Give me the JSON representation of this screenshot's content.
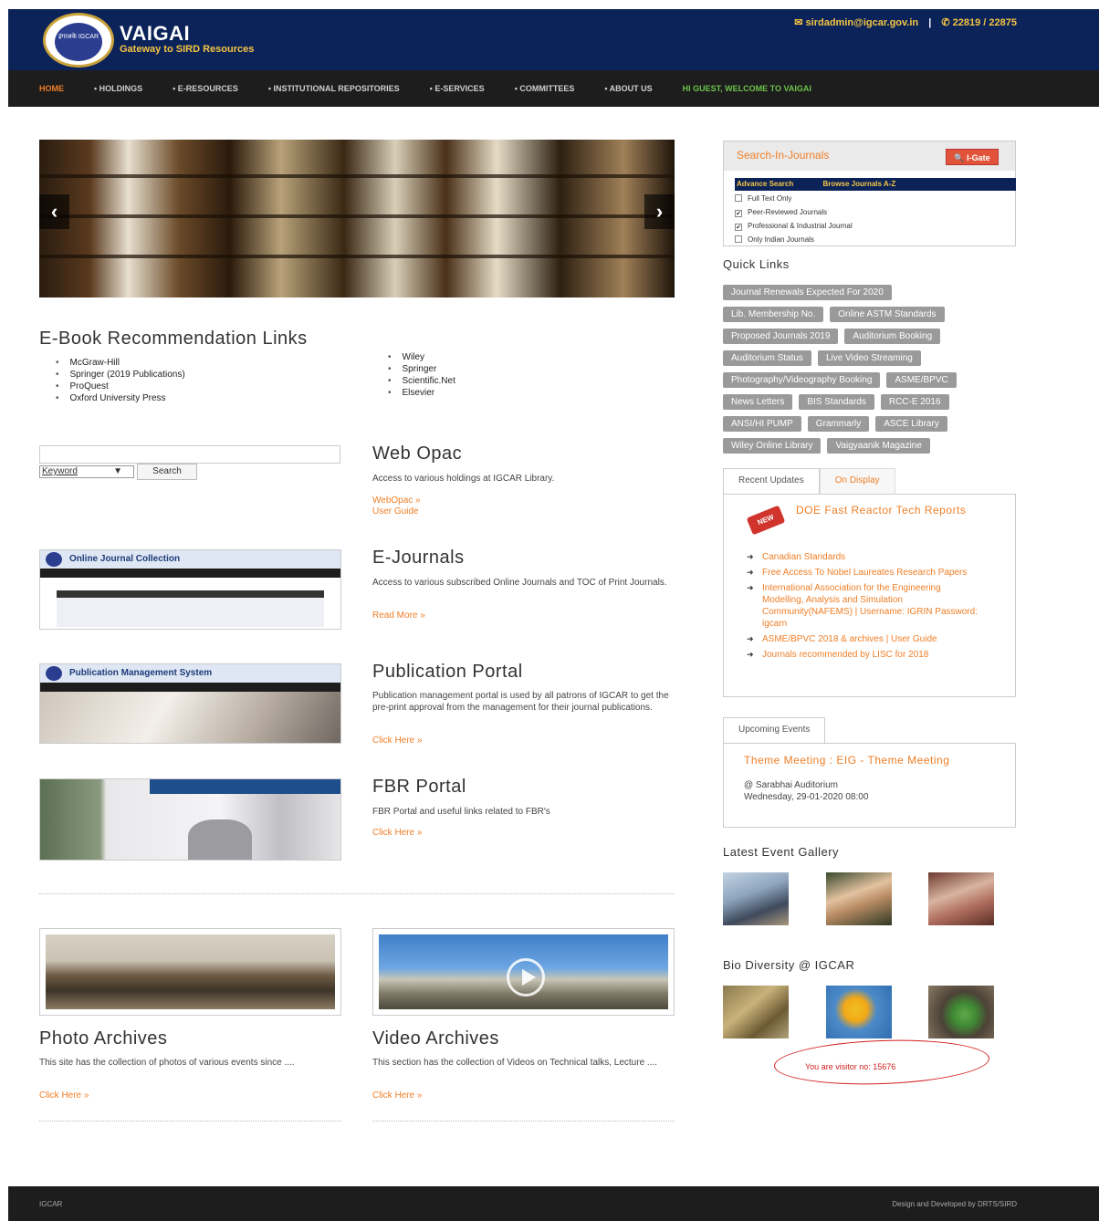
{
  "header": {
    "title": "VAIGAI",
    "subtitle": "Gateway to SIRD Resources",
    "logo_text": "इंगाअके IGCAR",
    "email": "sirdadmin@igcar.gov.in",
    "phone": "22819 / 22875",
    "separator": "|"
  },
  "nav": {
    "items": [
      "HOME",
      "• HOLDINGS",
      "• E-RESOURCES",
      "• INSTITUTIONAL REPOSITORIES",
      "• E-SERVICES",
      "• COMMITTEES",
      "• ABOUT US"
    ],
    "welcome": "HI GUEST, WELCOME TO VAIGAI"
  },
  "slider": {
    "prev": "‹",
    "next": "›"
  },
  "ebook": {
    "title": "E-Book Recommendation Links",
    "col1": [
      "McGraw-Hill",
      "Springer (2019 Publications)",
      "ProQuest",
      "Oxford University Press"
    ],
    "col2": [
      "Wiley",
      "Springer",
      "Scientific.Net",
      "Elsevier"
    ]
  },
  "search": {
    "input_value": "",
    "select_value": "Keyword",
    "button": "Search"
  },
  "webopac": {
    "title": "Web Opac",
    "desc": "Access to various holdings at IGCAR Library.",
    "link1": "WebOpac »",
    "link2": "User Guide"
  },
  "ejournals": {
    "title": "E-Journals",
    "desc": "Access to various subscribed Online Journals and TOC of Print Journals.",
    "link": "Read More »",
    "thumb_title": "Online Journal Collection"
  },
  "publication": {
    "title": "Publication Portal",
    "desc": "Publication management portal is used by all patrons of IGCAR to get the pre-print approval from the management for their journal publications.",
    "link": "Click Here »",
    "thumb_title": "Publication Management System"
  },
  "fbr": {
    "title": "FBR Portal",
    "desc": "FBR Portal and useful links related to FBR's",
    "link": "Click Here »"
  },
  "photo": {
    "title": "Photo Archives",
    "desc": "This site has the collection of photos of various events since ....",
    "link": "Click Here »"
  },
  "video": {
    "title": "Video Archives",
    "desc": "This section has the collection of Videos on Technical talks, Lecture ....",
    "link": "Click Here »"
  },
  "journal_search": {
    "title": "Search-In-Journals",
    "igate": "I-Gate",
    "advance": "Advance Search",
    "browse": "Browse Journals A-Z",
    "options": [
      {
        "label": "Full Text Only",
        "checked": false
      },
      {
        "label": "Peer-Reviewed Journals",
        "checked": true
      },
      {
        "label": "Professional & Industrial Journal",
        "checked": true
      },
      {
        "label": "Only Indian Journals",
        "checked": false
      }
    ]
  },
  "quick_links": {
    "title": "Quick Links",
    "items": [
      "Journal Renewals Expected For 2020",
      "Lib. Membership No.",
      "Online ASTM Standards",
      "Proposed Journals 2019",
      "Auditorium Booking",
      "Auditorium Status",
      "Live Video Streaming",
      "Photography/Videography Booking",
      "ASME/BPVC",
      "News Letters",
      "BIS Standards",
      "RCC-E 2016",
      "ANSI/HI PUMP",
      "Grammarly",
      "ASCE Library",
      "Wiley Online Library",
      "Vaigyaanik Magazine"
    ]
  },
  "updates": {
    "tab1": "Recent Updates",
    "tab2": "On Display",
    "badge": "NEW",
    "headline": "DOE Fast Reactor Tech Reports",
    "items": [
      "Canadian Standards",
      "Free Access To Nobel Laureates Research Papers",
      "International Association for the Engineering Modelling, Analysis and Simulation Community(NAFEMS) | Username: IGRIN Password: igcarn",
      "ASME/BPVC 2018 & archives | User Guide",
      "Journals recommended by LISC for 2018"
    ]
  },
  "events": {
    "tab": "Upcoming Events",
    "title": "Theme Meeting : EIG - Theme Meeting",
    "venue": "@ Sarabhai Auditorium",
    "date": "Wednesday, 29-01-2020 08:00"
  },
  "gallery": {
    "title": "Latest Event Gallery"
  },
  "biodiversity": {
    "title": "Bio Diversity @ IGCAR"
  },
  "visitor": {
    "text": "You are visitor no: 15676"
  },
  "footer": {
    "left": "IGCAR",
    "right": "Design and Developed by DRTS/SIRD"
  }
}
